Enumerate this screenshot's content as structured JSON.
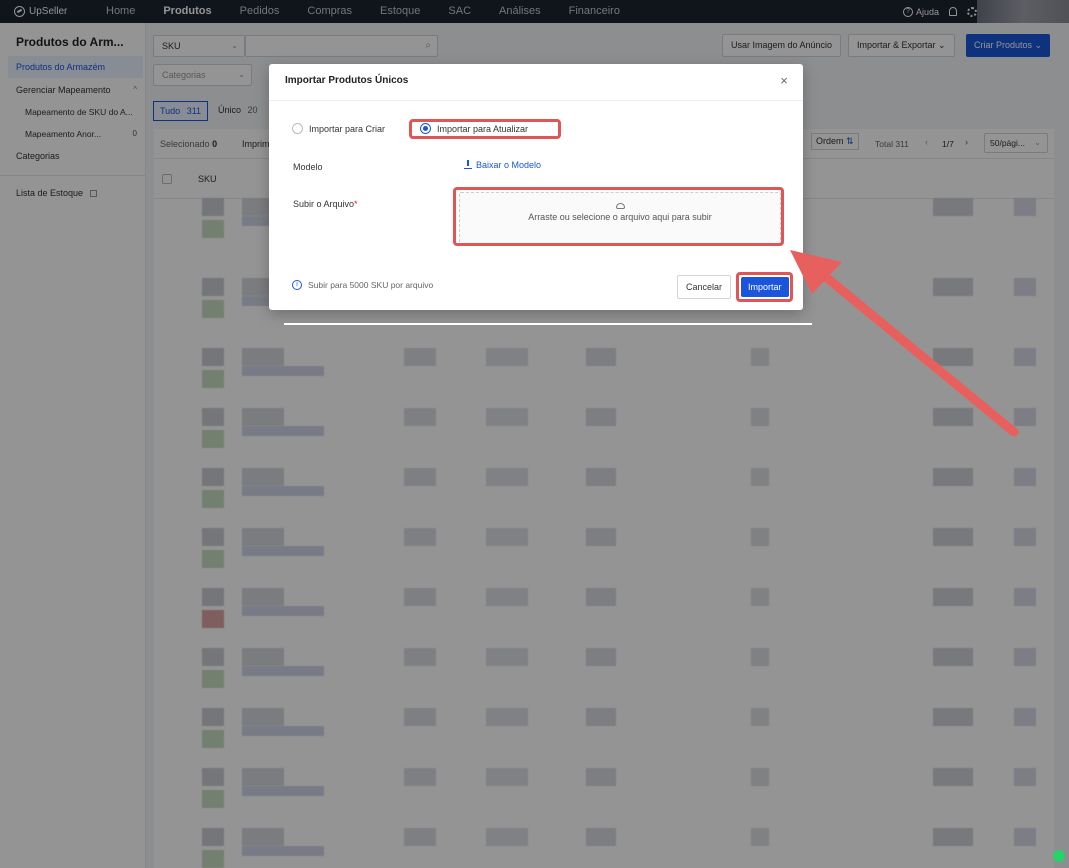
{
  "app": {
    "brand": "UpSeller"
  },
  "nav": {
    "items": [
      "Home",
      "Produtos",
      "Pedidos",
      "Compras",
      "Estoque",
      "SAC",
      "Análises",
      "Financeiro"
    ],
    "active": "Produtos",
    "help_label": "Ajuda"
  },
  "sidebar": {
    "title": "Produtos do Arm...",
    "items": [
      {
        "label": "Produtos do Armazém"
      },
      {
        "label": "Gerenciar Mapeamento"
      },
      {
        "label": "Mapeamento de SKU do A..."
      },
      {
        "label": "Mapeamento Anor...",
        "count": "0"
      },
      {
        "label": "Categorias"
      },
      {
        "label": "Lista de Estoque"
      }
    ]
  },
  "toolbar": {
    "search_field": "SKU",
    "categories_placeholder": "Categorias",
    "use_image_label": "Usar Imagem do Anúncio",
    "import_export_label": "Importar & Exportar",
    "create_label": "Criar Produtos"
  },
  "tabs": [
    {
      "label": "Tudo",
      "count": "311"
    },
    {
      "label": "Único",
      "count": "20"
    }
  ],
  "table": {
    "selected_label": "Selecionado",
    "selected_count": "0",
    "print_label": "Imprim",
    "order_label": "Ordem",
    "total_label": "Total 311",
    "page": "1/7",
    "page_size": "50/pági...",
    "col_sku": "SKU"
  },
  "modal": {
    "title": "Importar Produtos Únicos",
    "option_create": "Importar para Criar",
    "option_update": "Importar para Atualizar",
    "selected_option": "update",
    "model_label": "Modelo",
    "download_label": "Baixar o Modelo",
    "upload_label": "Subir o Arquivo",
    "upload_hint": "Arraste ou selecione o arquivo aqui para subir",
    "info_text": "Subir para 5000 SKU por arquivo",
    "cancel_label": "Cancelar",
    "import_label": "Importar"
  },
  "colors": {
    "primary": "#1a56db",
    "highlight": "#e05555",
    "nav_bg": "#1d2330"
  }
}
